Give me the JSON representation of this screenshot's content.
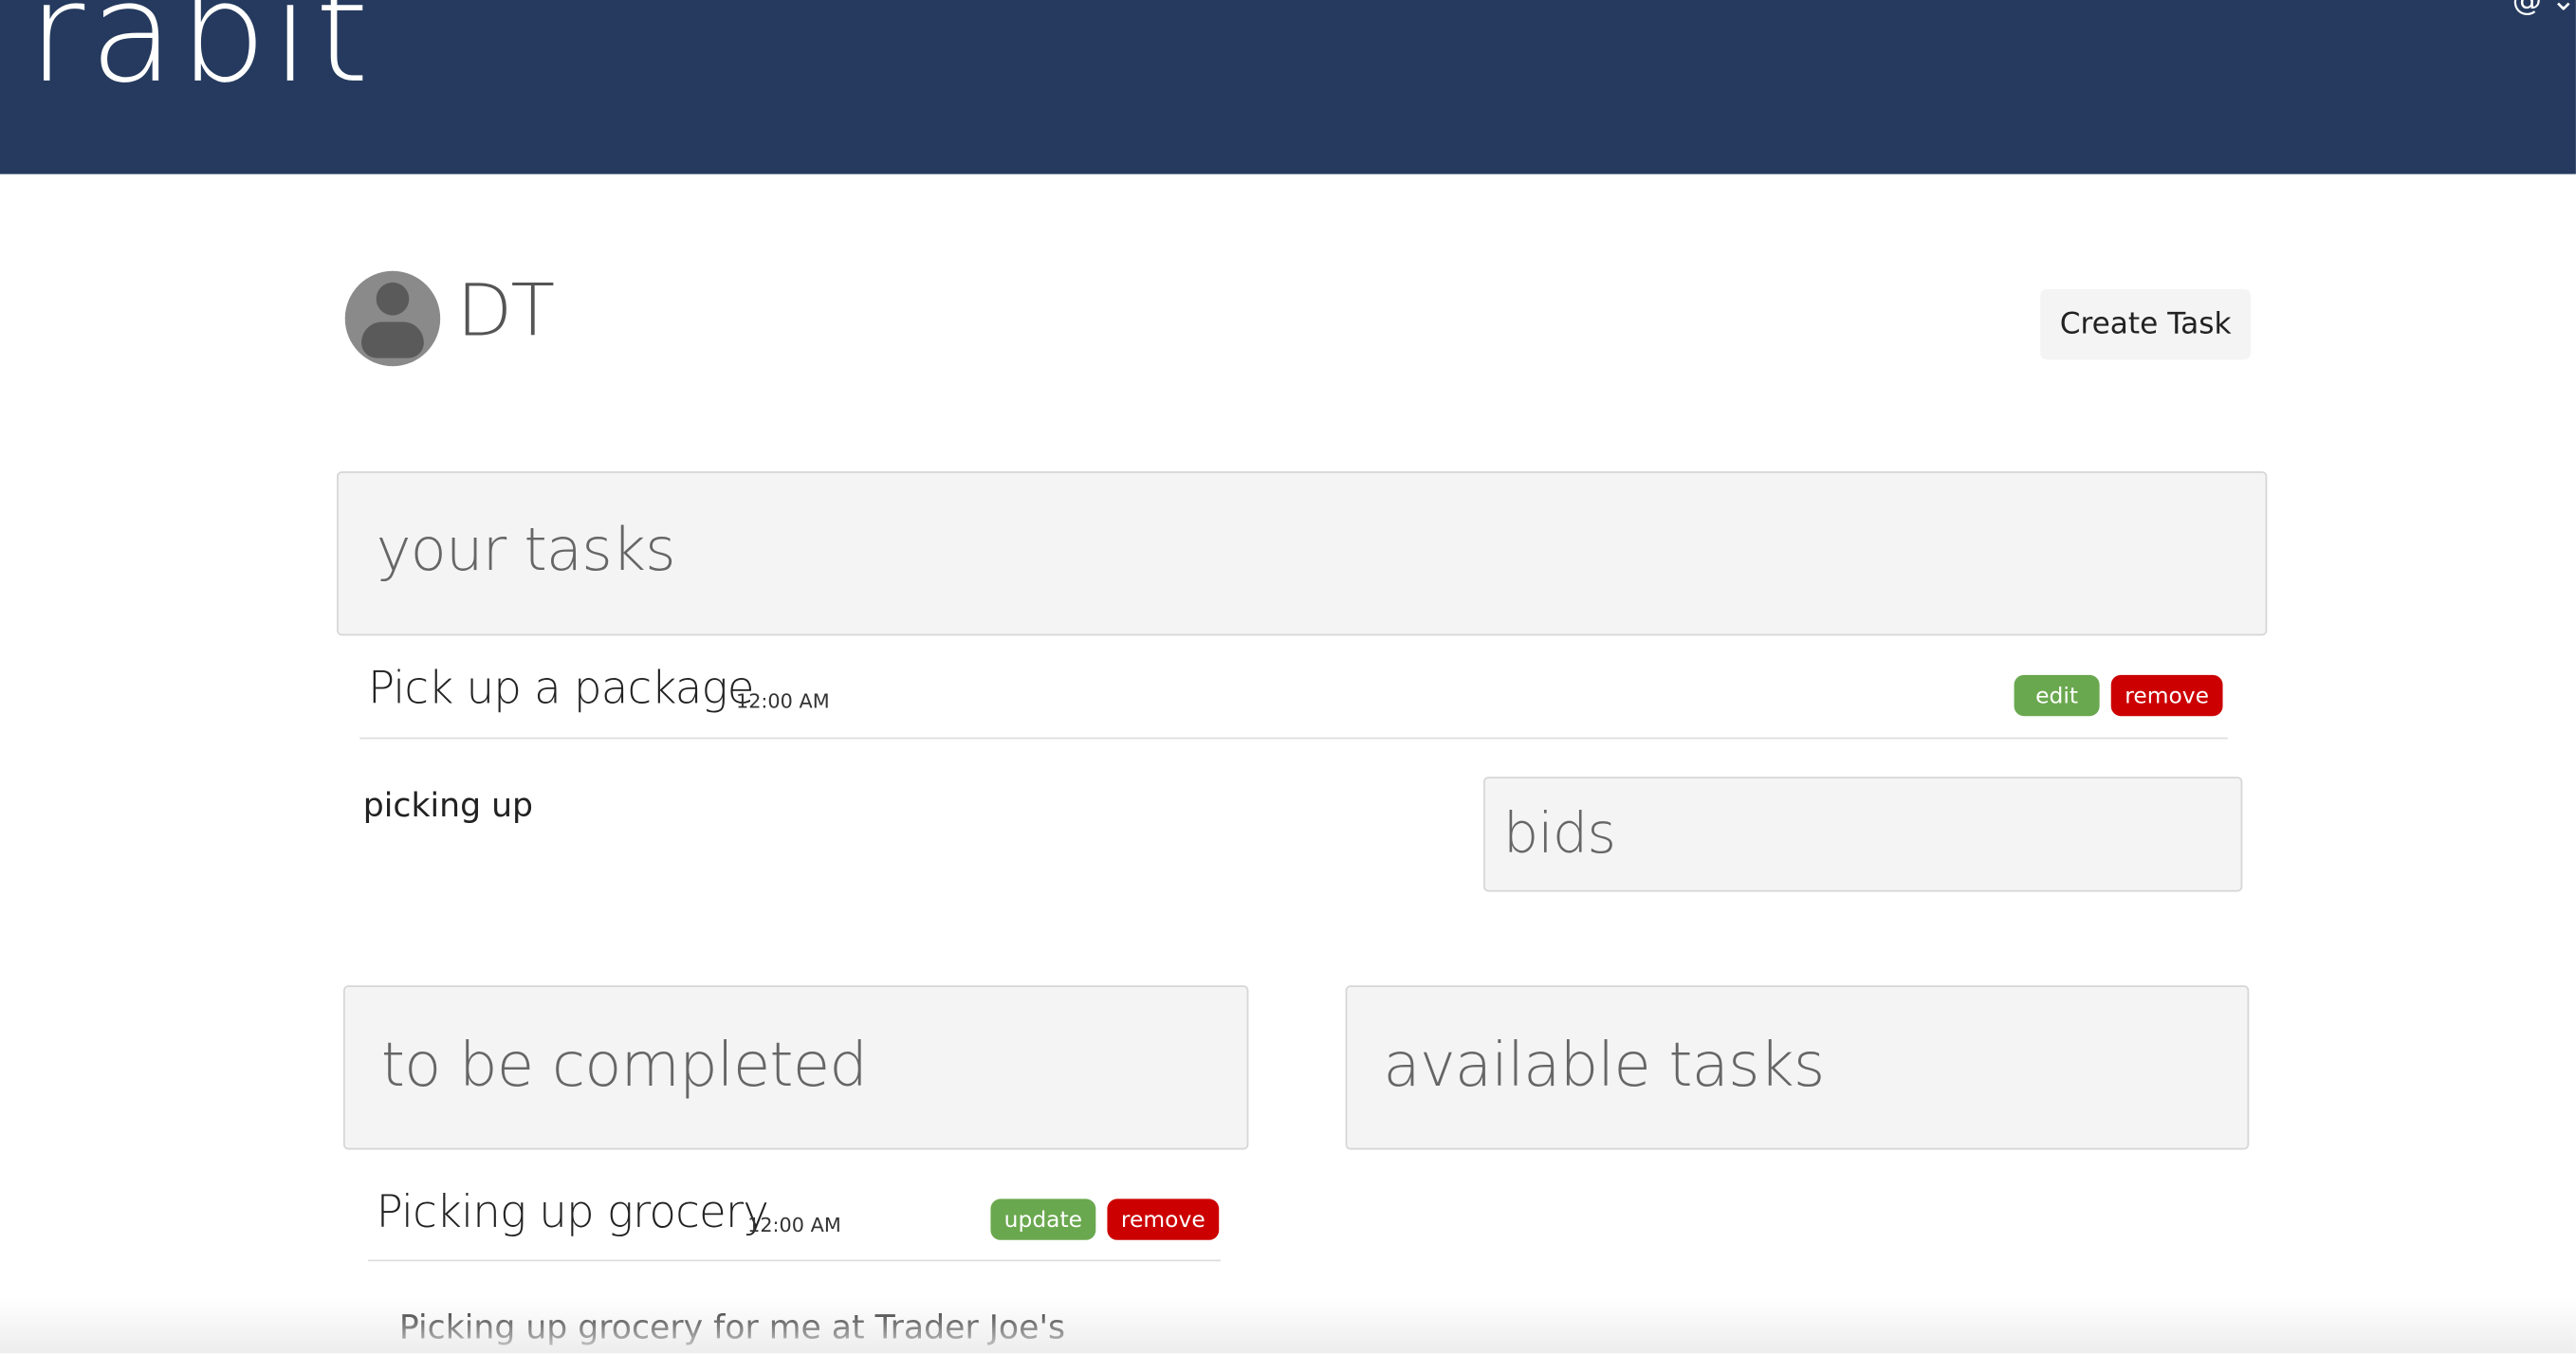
{
  "header": {
    "brand": "rabit",
    "account_menu": "@ ⌄",
    "colors": {
      "bar": "#253a5e",
      "brand_text": "#ffffff"
    }
  },
  "profile": {
    "name": "DT",
    "create_button": "Create Task"
  },
  "your_tasks": {
    "title": "your tasks",
    "tasks": [
      {
        "title": "Pick up a package",
        "time": "12:00 AM",
        "description": "picking up",
        "actions": {
          "edit": "edit",
          "remove": "remove"
        },
        "bids_title": "bids"
      }
    ]
  },
  "to_be_completed": {
    "title": "to be completed",
    "tasks": [
      {
        "title": "Picking up grocery",
        "time": "12:00 AM",
        "description": "Picking up grocery for me at Trader Joe's",
        "actions": {
          "update": "update",
          "remove": "remove"
        }
      }
    ]
  },
  "available_tasks": {
    "title": "available tasks"
  },
  "colors": {
    "badge_green": "#6aa84f",
    "badge_red": "#cc0000",
    "panel_bg": "#f4f4f4"
  }
}
